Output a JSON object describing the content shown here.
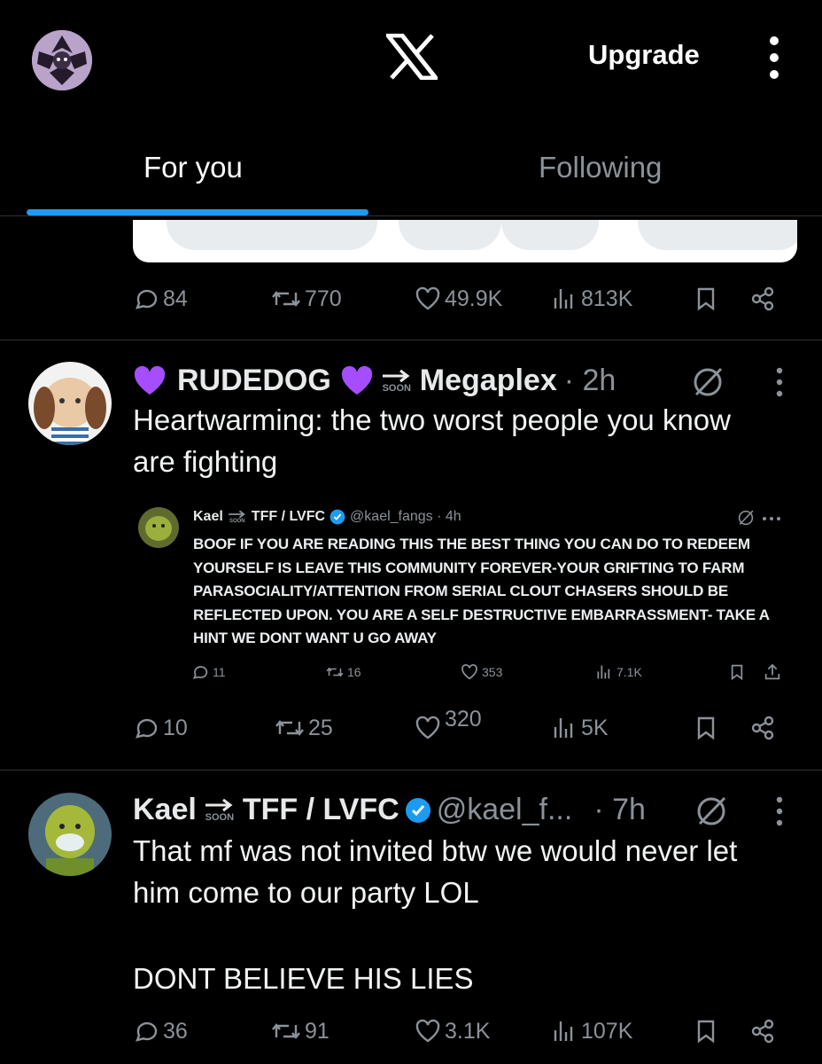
{
  "header": {
    "logo": "X",
    "upgrade_label": "Upgrade"
  },
  "tabs": [
    {
      "label": "For you",
      "active": true
    },
    {
      "label": "Following",
      "active": false
    }
  ],
  "prev_post": {
    "actions": {
      "replies": "84",
      "reposts": "770",
      "likes": "49.9K",
      "views": "813K"
    }
  },
  "post1": {
    "display_name": "RUDEDOG",
    "soon_label": "SOON",
    "name_suffix": "Megaplex",
    "time": "· 2h",
    "text": "Heartwarming: the two worst people you know are fighting",
    "quoted": {
      "name": "Kael",
      "soon_label": "SOON",
      "name_suffix": "TFF / LVFC",
      "handle": "@kael_fangs · 4h",
      "text": "BOOF IF YOU ARE READING THIS THE BEST THING YOU CAN DO TO REDEEM YOURSELF IS LEAVE THIS COMMUNITY FOREVER-YOUR GRIFTING TO FARM PARASOCIALITY/ATTENTION FROM SERIAL CLOUT CHASERS SHOULD BE REFLECTED UPON. YOU ARE A SELF DESTRUCTIVE EMBARRASSMENT- TAKE A HINT WE DONT WANT U GO AWAY",
      "actions": {
        "replies": "11",
        "reposts": "16",
        "likes": "353",
        "views": "7.1K"
      }
    },
    "actions": {
      "replies": "10",
      "reposts": "25",
      "likes": "320",
      "views": "5K"
    }
  },
  "post2": {
    "display_name": "Kael",
    "soon_label": "SOON",
    "name_suffix": "TFF / LVFC",
    "handle": "@kael_f...",
    "time": "· 7h",
    "text_line1": "That mf was not invited btw we would never let him come to our party LOL",
    "text_line2": "DONT BELIEVE HIS LIES",
    "actions": {
      "replies": "36",
      "reposts": "91",
      "likes": "3.1K",
      "views": "107K"
    }
  },
  "icons": [
    "profile-avatar",
    "x-logo-icon",
    "more-vertical-icon",
    "reply-icon",
    "repost-icon",
    "like-icon",
    "views-icon",
    "bookmark-icon",
    "share-icon",
    "grok-icon",
    "verified-badge-icon",
    "purple-heart-icon",
    "soon-arrow-icon"
  ],
  "colors": {
    "background": "#000000",
    "accent": "#1d9bf0",
    "secondary_text": "#8b9299",
    "heart": "#a64dff"
  }
}
